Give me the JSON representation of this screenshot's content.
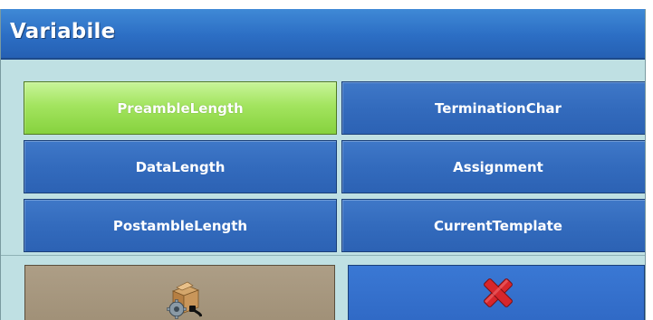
{
  "window": {
    "title": "Variabile"
  },
  "variables": [
    {
      "label": "PreambleLength",
      "selected": true
    },
    {
      "label": "TerminationChar",
      "selected": false
    },
    {
      "label": "DataLength",
      "selected": false
    },
    {
      "label": "Assignment",
      "selected": false
    },
    {
      "label": "PostambleLength",
      "selected": false
    },
    {
      "label": "CurrentTemplate",
      "selected": false
    }
  ],
  "softkeys": {
    "left": {
      "icon": "setup-box-gear-icon"
    },
    "right": {
      "icon": "cancel-x-icon"
    }
  },
  "colors": {
    "title_bar": "#2c6ec4",
    "background": "#bfe0e3",
    "button": "#336bbd",
    "selected_button": "#a3e45f",
    "setup_softkey": "#a39379",
    "cancel_softkey": "#2f68c4",
    "cancel_icon": "#d7262b"
  }
}
